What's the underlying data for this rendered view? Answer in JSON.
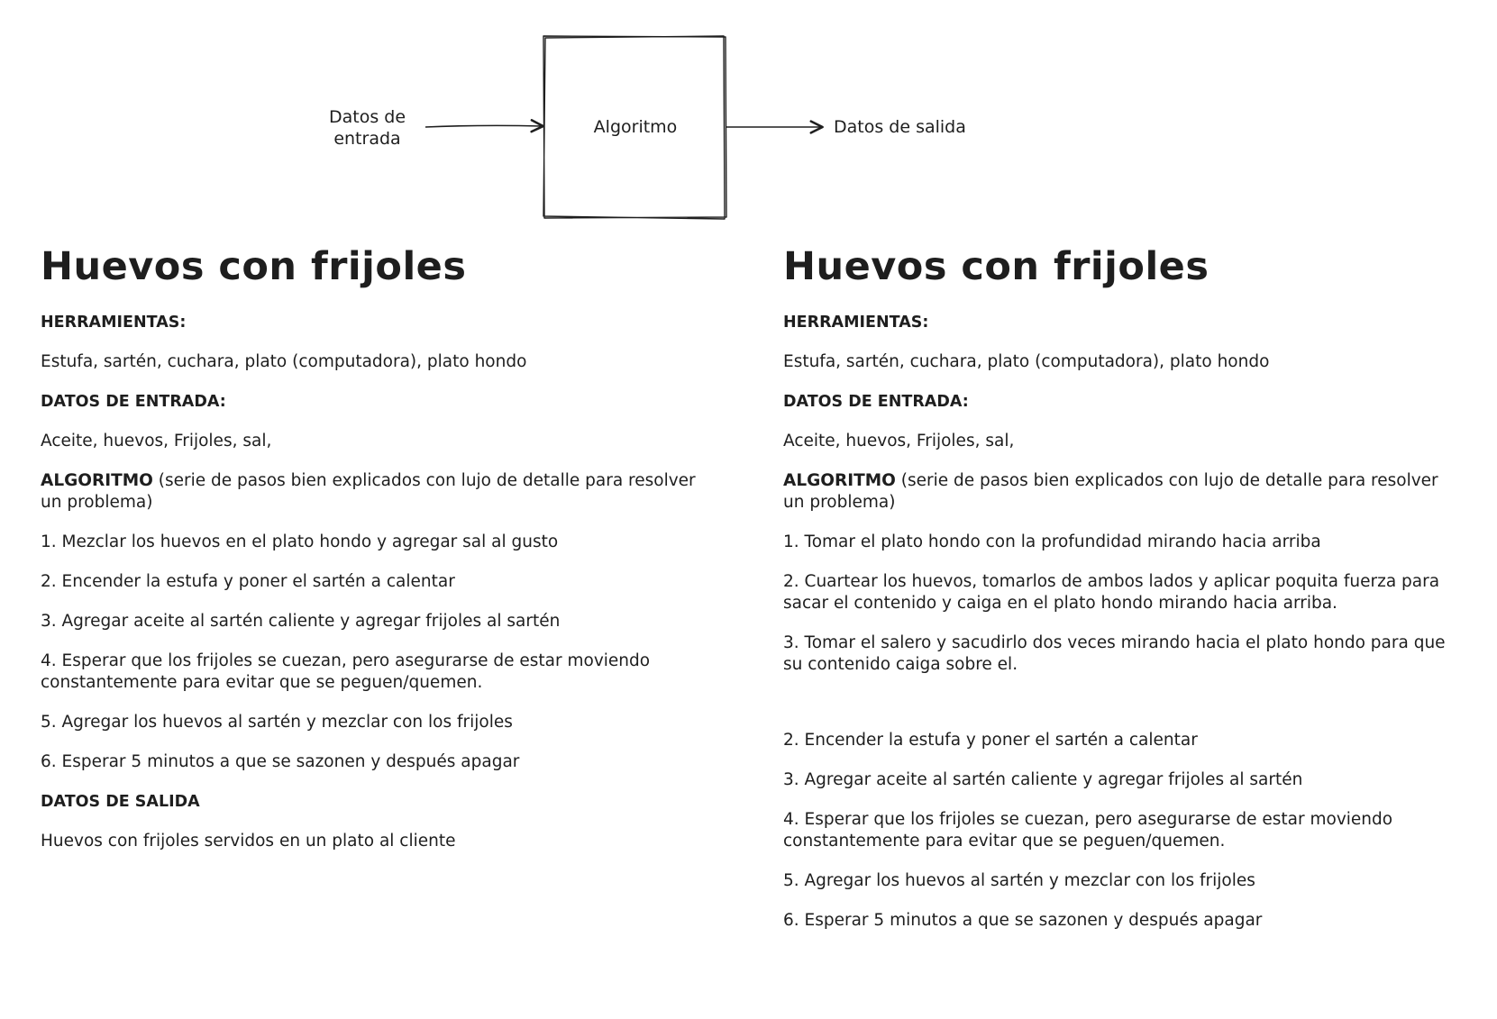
{
  "diagram": {
    "input_label_line1": "Datos de",
    "input_label_line2": "entrada",
    "box_label": "Algoritmo",
    "output_label": "Datos de salida"
  },
  "left_recipe": {
    "title": "Huevos con frijoles",
    "tools_heading": "HERRAMIENTAS:",
    "tools": "Estufa, sartén, cuchara, plato (computadora), plato hondo",
    "inputs_heading": "DATOS DE ENTRADA:",
    "inputs": "Aceite, huevos, Frijoles, sal,",
    "algorithm_heading": "ALGORITMO",
    "algorithm_desc": " (serie de pasos bien explicados con lujo de detalle para resolver un problema)",
    "steps": [
      "1. Mezclar los huevos en el plato hondo y agregar sal al gusto",
      "2. Encender la estufa y poner el sartén a calentar",
      "3. Agregar aceite al sartén caliente y agregar frijoles al sartén",
      "4. Esperar que los frijoles se cuezan, pero asegurarse de estar moviendo constantemente para evitar que se peguen/quemen.",
      "5. Agregar los huevos al sartén y mezclar con los frijoles",
      "6. Esperar 5 minutos a que se sazonen y después apagar"
    ],
    "outputs_heading": "DATOS DE SALIDA",
    "outputs": "Huevos con frijoles servidos en un plato al cliente"
  },
  "right_recipe": {
    "title": "Huevos con frijoles",
    "tools_heading": "HERRAMIENTAS:",
    "tools": "Estufa, sartén, cuchara, plato (computadora), plato hondo",
    "inputs_heading": "DATOS DE ENTRADA:",
    "inputs": "Aceite, huevos, Frijoles, sal,",
    "algorithm_heading": "ALGORITMO",
    "algorithm_desc": " (serie de pasos bien explicados con lujo de detalle para resolver un problema)",
    "detail_steps": [
      "1. Tomar el plato hondo con la profundidad mirando hacia arriba",
      "2. Cuartear los huevos, tomarlos de ambos lados y aplicar poquita fuerza para sacar el contenido y caiga en el plato hondo mirando hacia arriba.",
      "3. Tomar el salero y sacudirlo dos veces mirando hacia el plato hondo para que su contenido caiga sobre el."
    ],
    "steps": [
      "2. Encender la estufa y poner el sartén a calentar",
      "3. Agregar aceite al sartén caliente y agregar frijoles al sartén",
      "4. Esperar que los frijoles se cuezan, pero asegurarse de estar moviendo constantemente para evitar que se peguen/quemen.",
      "5. Agregar los huevos al sartén y mezclar con los frijoles",
      "6. Esperar 5 minutos a que se sazonen y después apagar"
    ]
  }
}
